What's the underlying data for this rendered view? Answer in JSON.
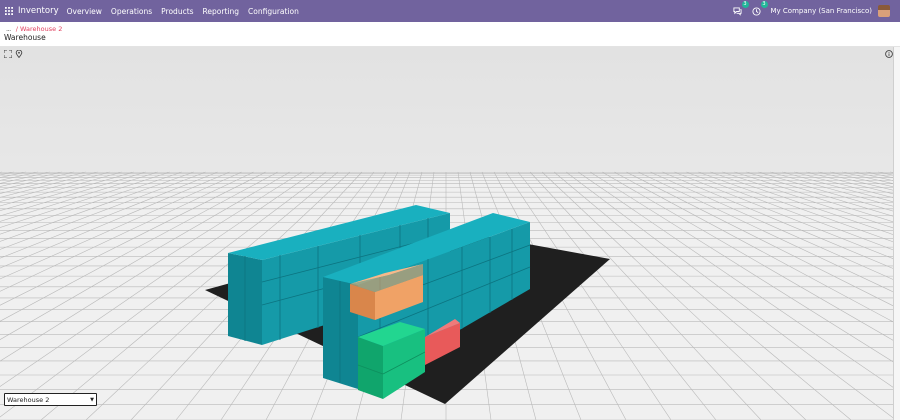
{
  "navbar": {
    "app_name": "Inventory",
    "menu": [
      "Overview",
      "Operations",
      "Products",
      "Reporting",
      "Configuration"
    ],
    "messages_count": "3",
    "activities_count": "3",
    "company": "My Company (San Francisco)",
    "apps_icon": "grid-icon",
    "messages_icon": "chat-icon",
    "activities_icon": "clock-icon",
    "bar_color": "#71639e",
    "badge_color": "#21b799"
  },
  "breadcrumb": {
    "dots": "...",
    "current": "/ Warehouse 2"
  },
  "page_title": "Warehouse",
  "viewer": {
    "toolbar_icons": [
      "fullscreen-icon",
      "location-pin-icon",
      "info-icon"
    ],
    "warehouse_select": {
      "value": "Warehouse 2",
      "options": [
        "Warehouse 2"
      ]
    },
    "colors": {
      "floor": "#1f1f1f",
      "rack": "#159aa8",
      "location_orange": "#f0a266",
      "location_green": "#18c080",
      "location_red": "#e85a5a",
      "background": "#e7e7e7",
      "grid": "#bdbdbd"
    }
  }
}
